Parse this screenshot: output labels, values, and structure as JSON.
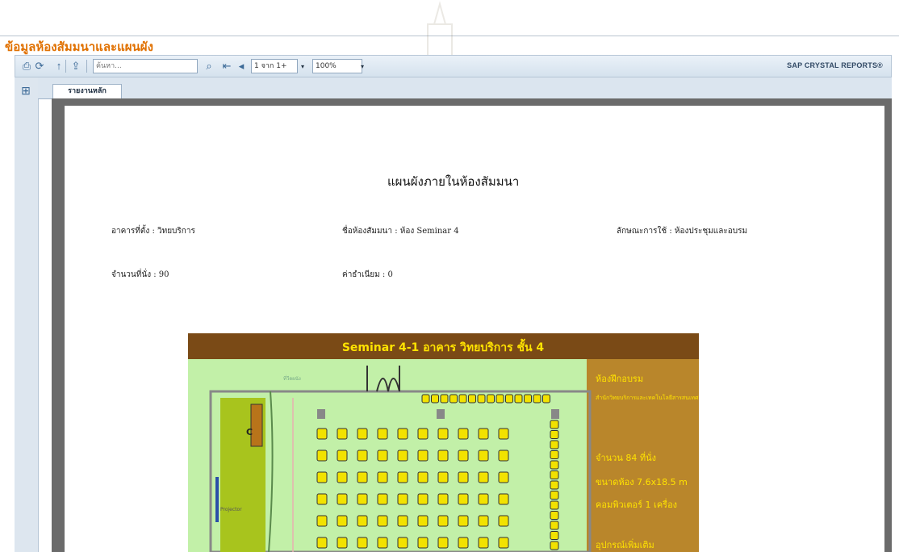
{
  "page": {
    "title": "ข้อมูลห้องสัมมนาและแผนผัง"
  },
  "toolbar": {
    "search_placeholder": "ค้นหา...",
    "page_nav": "1 จาก 1+",
    "zoom": "100%",
    "brand": "SAP CRYSTAL REPORTS®",
    "icons": [
      "print-icon",
      "export-icon",
      "refresh-icon",
      "up-icon",
      "binoculars-icon",
      "first-page-icon",
      "prev-page-icon"
    ]
  },
  "tabs": [
    {
      "label": "รายงานหลัก",
      "active": true
    }
  ],
  "report": {
    "title": "แผนผังภายในห้องสัมมนา",
    "building": "อาคารที่ตั้ง : วิทยบริการ",
    "room": "ชื่อห้องสัมมนา : ห้อง Seminar 4",
    "usage": "ลักษณะการใช้ : ห้องประชุมและอบรม",
    "seats": "จำนวนที่นั่ง :  90",
    "fee": "ค่าธำเนียม :  0"
  },
  "floorplan": {
    "title": "Seminar 4-1  อาคาร  วิทยบริการ  ชั้น 4",
    "panel_heading": "ห้องฝึกอบรม",
    "panel_sub": "สำนักวิทยบริการและเทคโนโลยีสารสนเทศ",
    "seats_text": "จำนวน  84  ที่นั่ง",
    "room_size": "ขนาดห้อง  7.6x18.5 m",
    "computers": "คอมพิวเตอร์  1  เครื่อง",
    "extra": "อุปกรณ์เพิ่มเติม",
    "projector_label": "Projector",
    "screen_label": "ที่วีดผนัง",
    "colors": {
      "header": "#7a4a16",
      "panel": "#b9862b",
      "floor": "#c2f0a8",
      "seat": "#f2e200"
    }
  }
}
